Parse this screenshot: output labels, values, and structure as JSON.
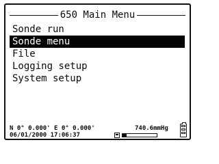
{
  "menu": {
    "title": "650 Main Menu",
    "items": [
      {
        "label": "Sonde run",
        "selected": false
      },
      {
        "label": "Sonde menu",
        "selected": true
      },
      {
        "label": "File",
        "selected": false
      },
      {
        "label": "Logging setup",
        "selected": false
      },
      {
        "label": "System setup",
        "selected": false
      }
    ]
  },
  "status": {
    "coordinates": "N 0° 0.000' E 0° 0.000'",
    "datetime": "06/01/2000 17:06:37",
    "pressure": "740.6mmHg",
    "memory_used_fraction": 0.12,
    "memory_icon": "memory-card-icon",
    "battery_icon": "battery-icon"
  },
  "colors": {
    "background": "#ffffff",
    "foreground": "#0a0a0a",
    "highlight": "#050505"
  }
}
